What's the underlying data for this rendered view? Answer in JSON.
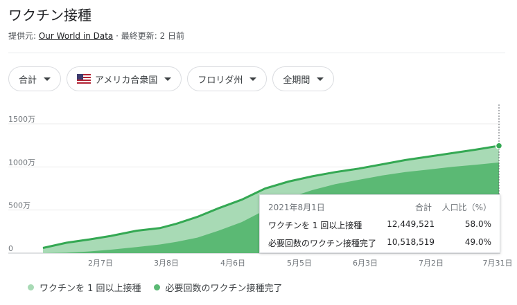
{
  "title": "ワクチン接種",
  "source": {
    "prefix": "提供元: ",
    "link": "Our World in Data",
    "separator": " · ",
    "updated": "最終更新: 2 日前"
  },
  "filters": [
    {
      "label": "合計"
    },
    {
      "label": "アメリカ合衆国",
      "icon": "us-flag-icon"
    },
    {
      "label": "フロリダ州"
    },
    {
      "label": "全期間"
    }
  ],
  "tooltip": {
    "date": "2021年8月1日",
    "col_total": "合計",
    "col_pct": "人口比（%）",
    "rows": [
      {
        "label": "ワクチンを 1 回以上接種",
        "total": "12,449,521",
        "pct": "58.0%"
      },
      {
        "label": "必要回数のワクチン接種完了",
        "total": "10,518,519",
        "pct": "49.0%"
      }
    ]
  },
  "legend": [
    {
      "label": "ワクチンを 1 回以上接種",
      "color": "#a8dab5"
    },
    {
      "label": "必要回数のワクチン接種完了",
      "color": "#5bb974"
    }
  ],
  "chart_data": {
    "type": "area",
    "y_ticks": [
      "0",
      "500万",
      "1000万",
      "1500万"
    ],
    "x_ticks": [
      "2月7日",
      "3月8日",
      "4月6日",
      "5月5日",
      "6月3日",
      "7月2日",
      "7月31日"
    ],
    "ylim": [
      0,
      1500
    ],
    "unit": "万",
    "x": [
      0,
      10,
      20,
      29,
      40,
      50,
      57,
      66,
      75,
      85,
      95,
      105,
      115,
      125,
      135,
      145,
      155,
      165,
      175,
      185,
      195
    ],
    "series": [
      {
        "name": "ワクチンを 1 回以上接種",
        "color": "#a8dab5",
        "line_color": "#34a853",
        "values": [
          60,
          120,
          160,
          200,
          260,
          290,
          340,
          420,
          520,
          620,
          750,
          830,
          890,
          940,
          980,
          1030,
          1080,
          1120,
          1160,
          1200,
          1245
        ]
      },
      {
        "name": "必要回数のワクチン接種完了",
        "color": "#5bb974",
        "values": [
          0,
          5,
          20,
          40,
          70,
          100,
          130,
          180,
          260,
          360,
          500,
          640,
          730,
          800,
          850,
          900,
          940,
          970,
          1000,
          1025,
          1052
        ]
      }
    ]
  }
}
